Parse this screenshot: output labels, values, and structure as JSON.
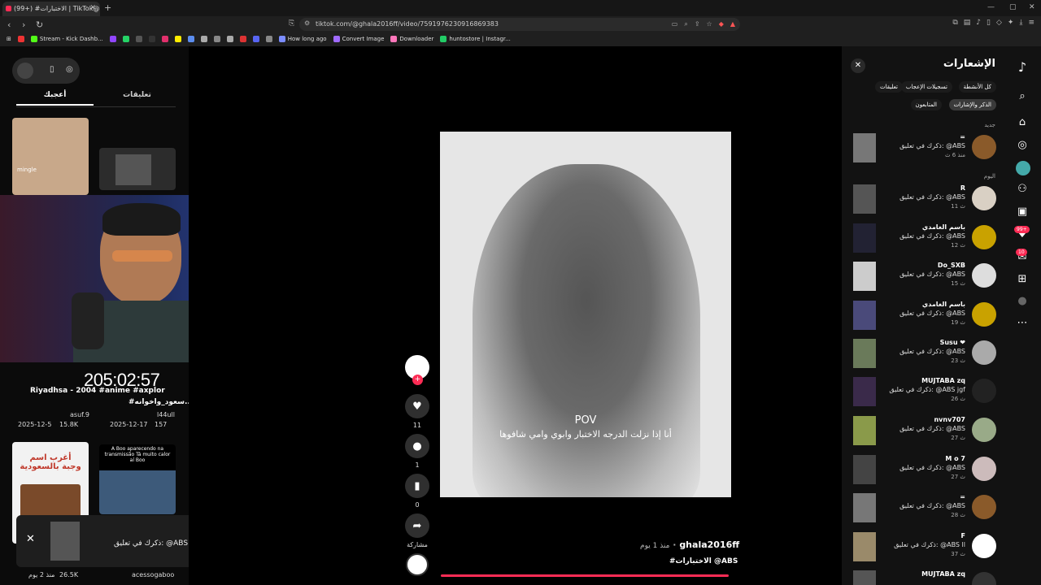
{
  "browser": {
    "tab_title": "(99+) #الاختبارات | TikTok@ :S",
    "url": "tiktok.com/@ghala2016ff/video/7591976230916869383",
    "bookmarks": [
      "Stream - Kick Dashb...",
      "How long ago",
      "Convert Image",
      "Downloader",
      "huntostore | Instagr..."
    ],
    "notif_badge": "2"
  },
  "left": {
    "tab_comments": "تعليقات",
    "tab_liked": "أعجبك",
    "timer": "205:02:57",
    "videos": [
      {
        "caption": "Riyadhsa - 2004 #anime #axplor",
        "user": "asuf.9",
        "date": "2025-12-5",
        "likes": "15.8K"
      },
      {
        "caption": "#سعود_واخوانه....",
        "user": "l44ull",
        "date": "2025-12-17",
        "likes": "157"
      },
      {
        "caption": "أغرب اسم وجبة بالسعودية",
        "user": "",
        "date": "منذ 2 يوم",
        "likes": "26.5K"
      },
      {
        "caption": "A Boo aparecendo na transmissão Tá muito calor aí Boo",
        "user": "acessogaboo",
        "date": "",
        "likes": ""
      }
    ],
    "thumb_label": "mingle"
  },
  "toast": {
    "title": "=",
    "text": "ذكرك في تعليق: @ABS"
  },
  "video": {
    "pov": "POV",
    "subtitle": "أنا إذا نزلت الدرجه الاختبار وابوي وامي شافوها",
    "likes": "11",
    "comments": "1",
    "saves": "0",
    "share": "مشاركة",
    "author": "ghala2016ff",
    "posted": "منذ 1 يوم",
    "hashtag": "#الاختبارات @ABS"
  },
  "notifications": {
    "title": "الإشعارات",
    "chips": [
      "كل الأنشطة",
      "تسجيلات الإعجاب",
      "تعليقات",
      "الذكر والإشارات",
      "المتابعون"
    ],
    "section_new": "جديد",
    "section_today": "اليوم",
    "items": [
      {
        "name": "=",
        "text": "ذكرك في تعليق: @ABS",
        "time": "منذ 6 ث"
      },
      {
        "name": "R",
        "text": "ذكرك في تعليق: @ABS",
        "time": "11 ث"
      },
      {
        "name": "باسم الغامدي",
        "text": "ذكرك في تعليق: @ABS",
        "time": "12 ث"
      },
      {
        "name": "Do_SXB",
        "text": "ذكرك في تعليق: @ABS",
        "time": "15 ث"
      },
      {
        "name": "باسم الغامدي",
        "text": "ذكرك في تعليق: @ABS",
        "time": "19 ث"
      },
      {
        "name": "Susu ❤",
        "text": "ذكرك في تعليق: @ABS",
        "time": "23 ث"
      },
      {
        "name": "MUJTABA zq",
        "text": "ذكرك في تعليق: @ABS jgf",
        "time": "26 ث"
      },
      {
        "name": "nvnv707",
        "text": "ذكرك في تعليق: @ABS",
        "time": "27 ث"
      },
      {
        "name": "M o 7",
        "text": "ذكرك في تعليق: @ABS",
        "time": "27 ث"
      },
      {
        "name": "=",
        "text": "ذكرك في تعليق: @ABS",
        "time": "28 ث"
      },
      {
        "name": "F",
        "text": "ذكرك في تعليق: @ABS اا",
        "time": "37 ث"
      },
      {
        "name": "MUJTABA zq",
        "text": "",
        "time": ""
      }
    ]
  },
  "rail": {
    "badge_activity": "99+",
    "badge_inbox": "10"
  }
}
